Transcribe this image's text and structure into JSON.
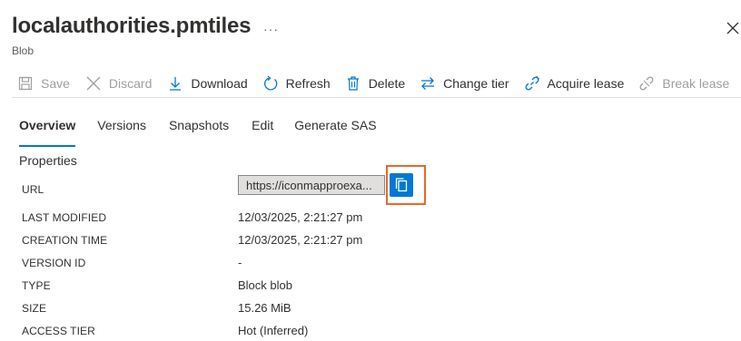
{
  "header": {
    "title": "localauthorities.pmtiles",
    "more": "···",
    "subtitle": "Blob"
  },
  "toolbar": {
    "save": "Save",
    "discard": "Discard",
    "download": "Download",
    "refresh": "Refresh",
    "delete": "Delete",
    "change_tier": "Change tier",
    "acquire_lease": "Acquire lease",
    "break_lease": "Break lease",
    "more": "···"
  },
  "tabs": [
    "Overview",
    "Versions",
    "Snapshots",
    "Edit",
    "Generate SAS"
  ],
  "properties": {
    "section_title": "Properties",
    "url_label": "URL",
    "url_value": "https://iconmapproexa...",
    "rows": [
      {
        "label": "LAST MODIFIED",
        "value": "12/03/2025, 2:21:27 pm"
      },
      {
        "label": "CREATION TIME",
        "value": "12/03/2025, 2:21:27 pm"
      },
      {
        "label": "VERSION ID",
        "value": "-"
      },
      {
        "label": "TYPE",
        "value": "Block blob"
      },
      {
        "label": "SIZE",
        "value": "15.26 MiB"
      },
      {
        "label": "ACCESS TIER",
        "value": "Hot (Inferred)"
      }
    ]
  },
  "colors": {
    "accent": "#0078d4",
    "highlight": "#e8692a",
    "disabled": "#a19f9d"
  }
}
